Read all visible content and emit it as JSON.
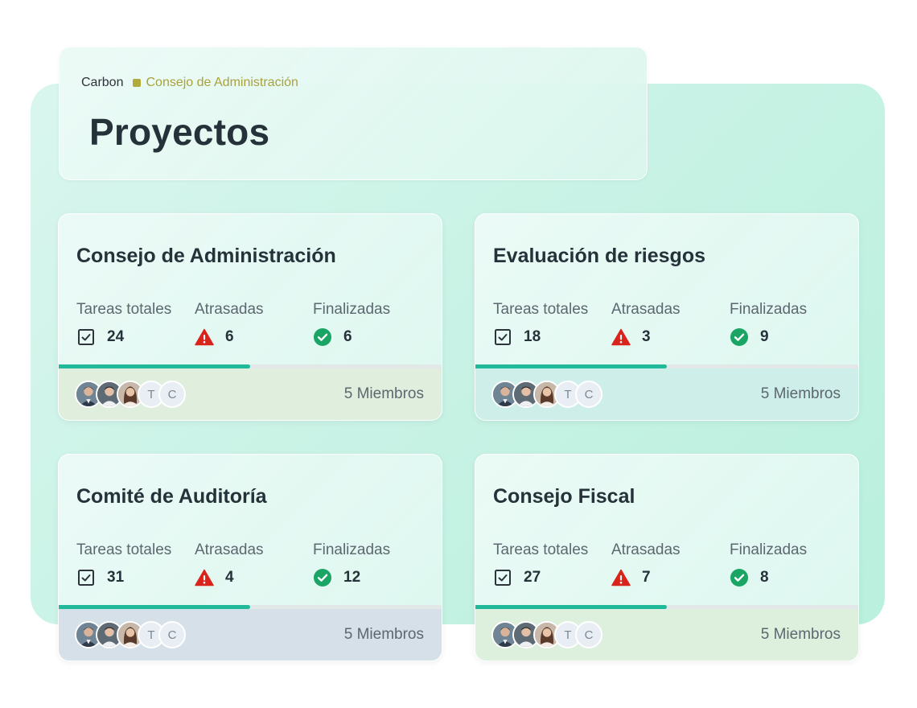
{
  "breadcrumb": {
    "root": "Carbon",
    "current": "Consejo de Administración",
    "dot_color": "#b1ab3b"
  },
  "page": {
    "title": "Proyectos"
  },
  "labels": {
    "total": "Tareas totales",
    "overdue": "Atrasadas",
    "done": "Finalizadas"
  },
  "colors": {
    "accent": "#20b99a",
    "warning": "#d9241c",
    "success": "#1aa564"
  },
  "icons": {
    "total": "checkbox-icon",
    "overdue": "warning-triangle-icon",
    "done": "check-circle-icon"
  },
  "projects": [
    {
      "title": "Consejo de Administración",
      "total": "24",
      "overdue": "6",
      "done": "6",
      "progress": 0.5,
      "members": "5 Miembros",
      "initials": [
        "T",
        "C"
      ]
    },
    {
      "title": "Evaluación de riesgos",
      "total": "18",
      "overdue": "3",
      "done": "9",
      "progress": 0.5,
      "members": "5 Miembros",
      "initials": [
        "T",
        "C"
      ]
    },
    {
      "title": "Comité de Auditoría",
      "total": "31",
      "overdue": "4",
      "done": "12",
      "progress": 0.5,
      "members": "5 Miembros",
      "initials": [
        "T",
        "C"
      ]
    },
    {
      "title": "Consejo Fiscal",
      "total": "27",
      "overdue": "7",
      "done": "8",
      "progress": 0.5,
      "members": "5 Miembros",
      "initials": [
        "T",
        "C"
      ]
    }
  ]
}
